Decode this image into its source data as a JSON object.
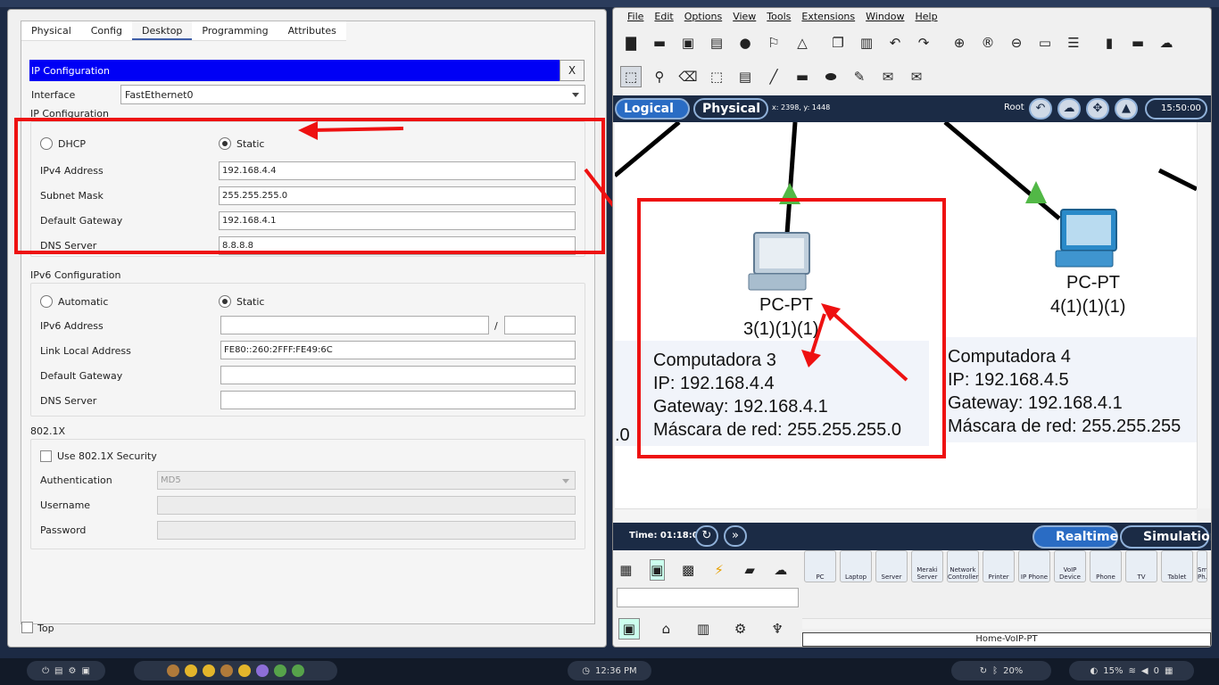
{
  "left_window": {
    "tabs": [
      "Physical",
      "Config",
      "Desktop",
      "Programming",
      "Attributes"
    ],
    "active_tab": "Desktop",
    "ip_config_title": "IP Configuration",
    "close_label": "X",
    "interface_label": "Interface",
    "interface_value": "FastEthernet0",
    "ipv4_section": "IP Configuration",
    "dhcp_label": "DHCP",
    "static_label": "Static",
    "ipv4_address_label": "IPv4 Address",
    "ipv4_address": "192.168.4.4",
    "subnet_mask_label": "Subnet Mask",
    "subnet_mask": "255.255.255.0",
    "default_gateway_label": "Default Gateway",
    "default_gateway": "192.168.4.1",
    "dns_server_label": "DNS Server",
    "dns_server": "8.8.8.8",
    "ipv6_section": "IPv6 Configuration",
    "automatic_label": "Automatic",
    "ipv6_static_label": "Static",
    "ipv6_address_label": "IPv6 Address",
    "ipv6_address": "",
    "ipv6_prefix_sep": "/",
    "ipv6_prefix": "",
    "link_local_label": "Link Local Address",
    "link_local": "FE80::260:2FFF:FE49:6C",
    "ipv6_gateway_label": "Default Gateway",
    "ipv6_gateway": "",
    "ipv6_dns_label": "DNS Server",
    "ipv6_dns": "",
    "dot1x_section": "802.1X",
    "use_8021x_label": "Use 802.1X Security",
    "authentication_label": "Authentication",
    "authentication_value": "MD5",
    "username_label": "Username",
    "password_label": "Password",
    "top_label": "Top"
  },
  "right_window": {
    "menus": [
      "File",
      "Edit",
      "Options",
      "View",
      "Tools",
      "Extensions",
      "Window",
      "Help"
    ],
    "logical_label": "Logical",
    "physical_label": "Physical",
    "coords": "x: 2398, y: 1448",
    "root_label": "Root",
    "clock": "15:50:00",
    "pc3": {
      "name": "PC-PT",
      "id": "3(1)(1)(1)",
      "note": [
        "Computadora 3",
        "IP: 192.168.4.4",
        "Gateway: 192.168.4.1",
        "Máscara de red: 255.255.255.0"
      ]
    },
    "pc4": {
      "name": "PC-PT",
      "id": "4(1)(1)(1)",
      "note": [
        "Computadora 4",
        "IP: 192.168.4.5",
        "Gateway: 192.168.4.1",
        "Máscara de red: 255.255.255"
      ]
    },
    "edge_text": ".0",
    "time_label": "Time: 01:18:04",
    "realtime_label": "Realtime",
    "simulation_label": "Simulation",
    "devices": [
      "PC",
      "Laptop",
      "Server",
      "Meraki Server",
      "Network Controller",
      "Printer",
      "IP Phone",
      "VoIP Device",
      "Phone",
      "TV",
      "Tablet",
      "Sm. Ph."
    ],
    "status_text": "Home-VoIP-PT"
  },
  "taskbar": {
    "clock": "12:36 PM",
    "bluetooth_battery": "20%",
    "volume": "15%",
    "notif": "0"
  },
  "colors": {
    "highlight_red": "#ee1111",
    "ip_bar": "#0000f5",
    "dark_bar": "#1b2b45",
    "accent_blue": "#2a6cc4"
  }
}
